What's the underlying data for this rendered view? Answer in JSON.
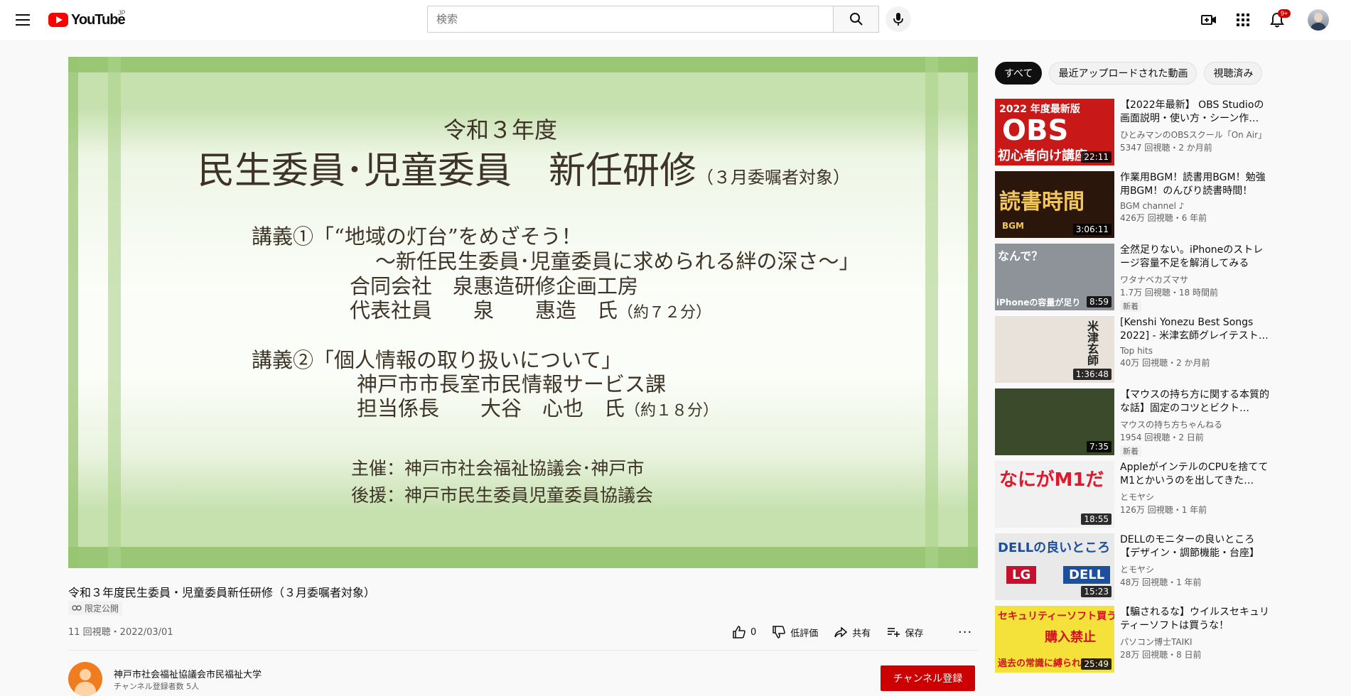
{
  "header": {
    "logo_text": "YouTube",
    "logo_region": "JP",
    "search_placeholder": "検索",
    "notification_count": "9+"
  },
  "video": {
    "slide": {
      "year": "令和３年度",
      "title_main": "民生委員･児童委員　新任研修",
      "title_sub": "（３月委嘱者対象）",
      "lecture1_title": "講義①「“地域の灯台”をめざそう！",
      "lecture1_subtitle": "～新任民生委員･児童委員に求められる絆の深さ～」",
      "lecture1_org": "合同会社　泉惠造研修企画工房",
      "lecture1_speaker": "代表社員　　泉　　惠造　氏",
      "lecture1_duration": "（約７２分）",
      "lecture2_title": "講義②「個人情報の取り扱いについて」",
      "lecture2_org": "神戸市市長室市民情報サービス課",
      "lecture2_speaker": "担当係長　　大谷　心也　氏",
      "lecture2_duration": "（約１８分）",
      "host": "主催：神戸市社会福祉協議会･神戸市",
      "support": "後援：神戸市民生委員児童委員協議会"
    },
    "title": "令和３年度民生委員・児童委員新任研修（３月委嘱者対象）",
    "privacy_label": "限定公開",
    "meta": "11 回視聴・2022/03/01",
    "likes": "0",
    "dislike_label": "低評価",
    "share_label": "共有",
    "save_label": "保存",
    "channel_name": "神戸市社会福祉協議会市民福祉大学",
    "channel_subs": "チャンネル登録者数 5人",
    "subscribe_label": "チャンネル登録"
  },
  "sidebar": {
    "chips": [
      "すべて",
      "最近アップロードされた動画",
      "視聴済み"
    ],
    "recommendations": [
      {
        "title": "【2022年最新】 OBS Studioの画面説明・使い方・シーン作…",
        "channel": "ひとみマンのOBSスクール「On Air」",
        "stats": "5347 回視聴・2 か月前",
        "duration": "22:11",
        "new": "",
        "thumb_text": "2022 年度最新版",
        "thumb_text2": "OBS",
        "thumb_text3": "初心者向け講座",
        "thumb_bg": "#c81818",
        "thumb_fg": "#ffffff"
      },
      {
        "title": "作業用BGM！読書用BGM！勉強用BGM！のんびり読書時間！",
        "channel": "BGM channel ♪",
        "stats": "426万 回視聴・6 年前",
        "duration": "3:06:11",
        "new": "",
        "thumb_text": "読書時間",
        "thumb_text2": "BGM",
        "thumb_text3": "",
        "thumb_bg": "#2a160a",
        "thumb_fg": "#f2c65a"
      },
      {
        "title": "全然足りない。iPhoneのストレージ容量不足を解消してみる",
        "channel": "ワタナベカズマサ",
        "stats": "1.7万 回視聴・18 時間前",
        "duration": "8:59",
        "new": "新着",
        "thumb_text": "なんで？",
        "thumb_text2": "",
        "thumb_text3": "iPhoneの容量が足り",
        "thumb_bg": "#8e939a",
        "thumb_fg": "#ffffff"
      },
      {
        "title": "[Kenshi Yonezu Best Songs 2022] - 米津玄師グレイテスト…",
        "channel": "Top hits",
        "stats": "40万 回視聴・2 か月前",
        "duration": "1:36:48",
        "new": "",
        "thumb_text": "米津玄師",
        "thumb_text2": "",
        "thumb_text3": "",
        "thumb_bg": "#e8e2da",
        "thumb_fg": "#222222"
      },
      {
        "title": "【マウスの持ち方に関する本質的な話】固定のコツとビクト…",
        "channel": "マウスの持ち方ちゃんねる",
        "stats": "1954 回視聴・2 日前",
        "duration": "7:35",
        "new": "新着",
        "thumb_text": "",
        "thumb_text2": "",
        "thumb_text3": "",
        "thumb_bg": "#3b4a2a",
        "thumb_fg": "#ffffff"
      },
      {
        "title": "AppleがインテルのCPUを捨ててM1とかいうのを出してきた…",
        "channel": "とモヤシ",
        "stats": "126万 回視聴・1 年前",
        "duration": "18:55",
        "new": "",
        "thumb_text": "なにがM1だ",
        "thumb_text2": "",
        "thumb_text3": "",
        "thumb_bg": "#f1f1f1",
        "thumb_fg": "#e0182d"
      },
      {
        "title": "DELLのモニターの良いところ【デザイン・調節機能・台座】",
        "channel": "とモヤシ",
        "stats": "48万 回視聴・1 年前",
        "duration": "15:23",
        "new": "",
        "thumb_text": "DELLの良いところ",
        "thumb_text2": "LG",
        "thumb_text3": "DELL",
        "thumb_bg": "#e9e9ea",
        "thumb_fg": "#1c4f9c"
      },
      {
        "title": "【騙されるな】ウイルスセキュリティーソフトは買うな！",
        "channel": "パソコン博士TAIKI",
        "stats": "28万 回視聴・8 日前",
        "duration": "25:49",
        "new": "",
        "thumb_text": "セキュリティーソフト買うな！",
        "thumb_text2": "購入禁止",
        "thumb_text3": "過去の常識に縛られるな",
        "thumb_bg": "#f4e23a",
        "thumb_fg": "#d4121f"
      }
    ]
  }
}
